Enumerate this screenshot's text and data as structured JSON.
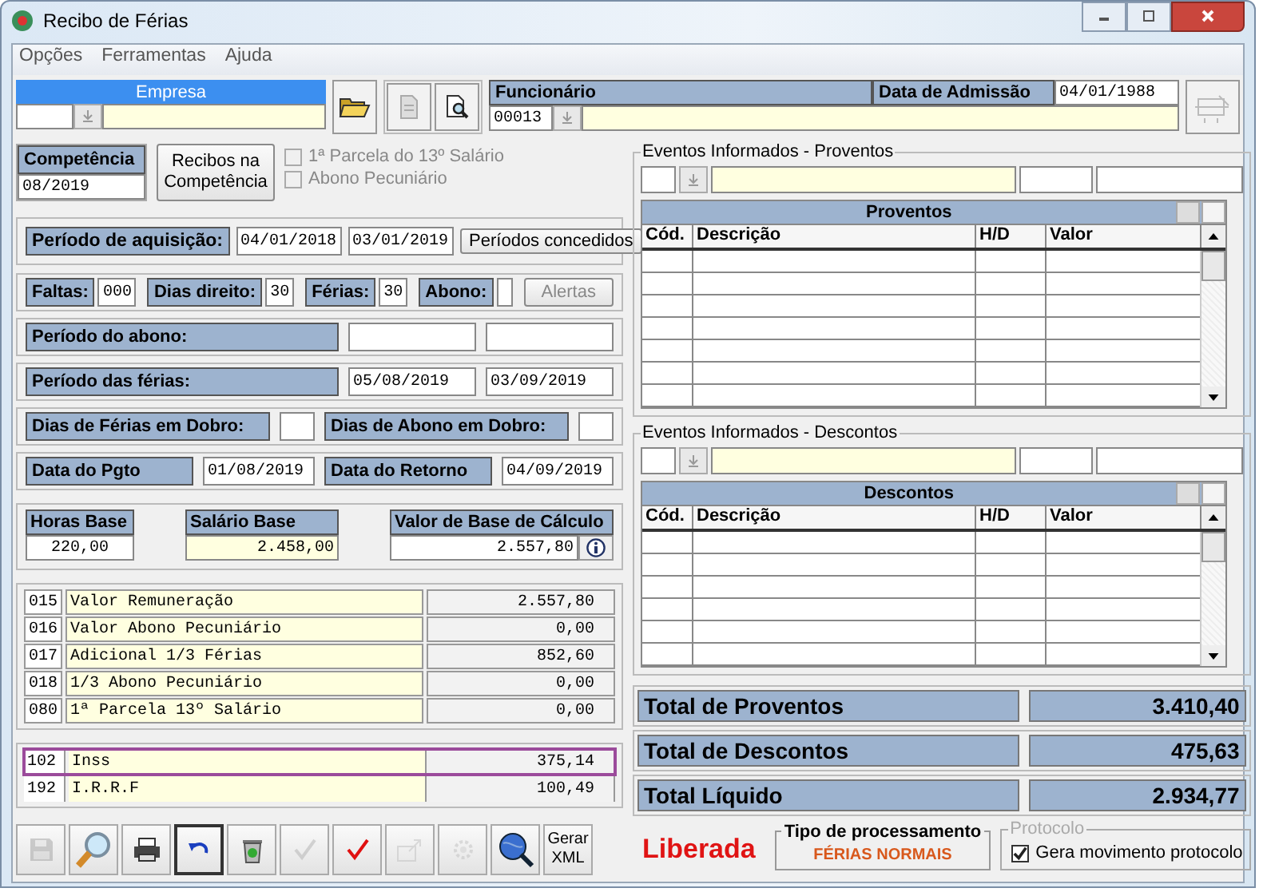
{
  "window": {
    "title": "Recibo de Férias"
  },
  "menu": [
    "Opções",
    "Ferramentas",
    "Ajuda"
  ],
  "empresa": {
    "label": "Empresa"
  },
  "funcionario": {
    "label": "Funcionário",
    "code": "00013"
  },
  "admissao": {
    "label": "Data de Admissão",
    "value": "04/01/1988"
  },
  "competencia": {
    "label": "Competência",
    "value": "08/2019"
  },
  "recibos_button": "Recibos na Competência",
  "options": [
    {
      "label": "1ª Parcela do 13º Salário",
      "checked": false,
      "disabled": true
    },
    {
      "label": "Abono Pecuniário",
      "checked": false,
      "disabled": true
    }
  ],
  "aquisicao": {
    "label": "Período de aquisição:",
    "start": "04/01/2018",
    "end": "03/01/2019",
    "button": "Períodos concedidos"
  },
  "counts": [
    {
      "label": "Faltas:",
      "value": "000"
    },
    {
      "label": "Dias direito:",
      "value": "30"
    },
    {
      "label": "Férias:",
      "value": "30"
    },
    {
      "label": "Abono:"
    }
  ],
  "alertas_button": {
    "label": "Alertas",
    "disabled": true
  },
  "periods": [
    {
      "label": "Período do abono:"
    },
    {
      "label": "Período das férias:",
      "start": "05/08/2019",
      "end": "03/09/2019"
    }
  ],
  "dobro": [
    {
      "label": "Dias de Férias em Dobro:"
    },
    {
      "label": "Dias de Abono em Dobro:"
    }
  ],
  "dates": [
    {
      "label": "Data do Pgto",
      "value": "01/08/2019"
    },
    {
      "label": "Data do Retorno",
      "value": "04/09/2019"
    }
  ],
  "bases": [
    {
      "label": "Horas Base",
      "value": "220,00"
    },
    {
      "label": "Salário Base",
      "value": "2.458,00"
    },
    {
      "label": "Valor de Base de Cálculo",
      "value": "2.557,80"
    }
  ],
  "earnings": [
    {
      "code": "015",
      "description": "Valor Remuneração",
      "value": "2.557,80"
    },
    {
      "code": "016",
      "description": "Valor Abono Pecuniário",
      "value": "0,00"
    },
    {
      "code": "017",
      "description": "Adicional 1/3 Férias",
      "value": "852,60"
    },
    {
      "code": "018",
      "description": "1/3 Abono Pecuniário",
      "value": "0,00"
    },
    {
      "code": "080",
      "description": "1ª Parcela 13º Salário",
      "value": "0,00"
    }
  ],
  "deductions": [
    {
      "code": "102",
      "description": "Inss",
      "value": "375,14",
      "selected": true
    },
    {
      "code": "192",
      "description": "I.R.R.F",
      "value": "100,49",
      "selected": false
    }
  ],
  "toolbar": [
    {
      "kind": "save",
      "disabled": true,
      "focused": false
    },
    {
      "kind": "search",
      "disabled": false,
      "focused": false
    },
    {
      "kind": "print",
      "disabled": false,
      "focused": false
    },
    {
      "kind": "undo",
      "disabled": false,
      "focused": true
    },
    {
      "kind": "recycle",
      "disabled": false,
      "focused": false
    },
    {
      "kind": "check",
      "disabled": true,
      "focused": false
    },
    {
      "kind": "check",
      "disabled": false,
      "focused": false
    },
    {
      "kind": "export",
      "disabled": true,
      "focused": false
    },
    {
      "kind": "gear",
      "disabled": true,
      "focused": false
    },
    {
      "kind": "globe",
      "disabled": false,
      "focused": false
    },
    {
      "kind": "text",
      "label": "Gerar XML",
      "disabled": false,
      "focused": false
    }
  ],
  "status": "Liberada",
  "tipo": {
    "title": "Tipo de processamento",
    "value": "FÉRIAS NORMAIS"
  },
  "protocolo": {
    "title": "Protocolo",
    "label": "Gera movimento protocolo",
    "checked": true
  },
  "grids": [
    {
      "group": "Eventos Informados - Proventos",
      "title": "Proventos",
      "columns": [
        "Cód.",
        "Descrição",
        "H/D",
        "Valor"
      ]
    },
    {
      "group": "Eventos Informados - Descontos",
      "title": "Descontos",
      "columns": [
        "Cód.",
        "Descrição",
        "H/D",
        "Valor"
      ]
    }
  ],
  "totals": [
    {
      "label": "Total de Proventos",
      "value": "3.410,40"
    },
    {
      "label": "Total de Descontos",
      "value": "475,63"
    },
    {
      "label": "Total Líquido",
      "value": "2.934,77"
    }
  ]
}
